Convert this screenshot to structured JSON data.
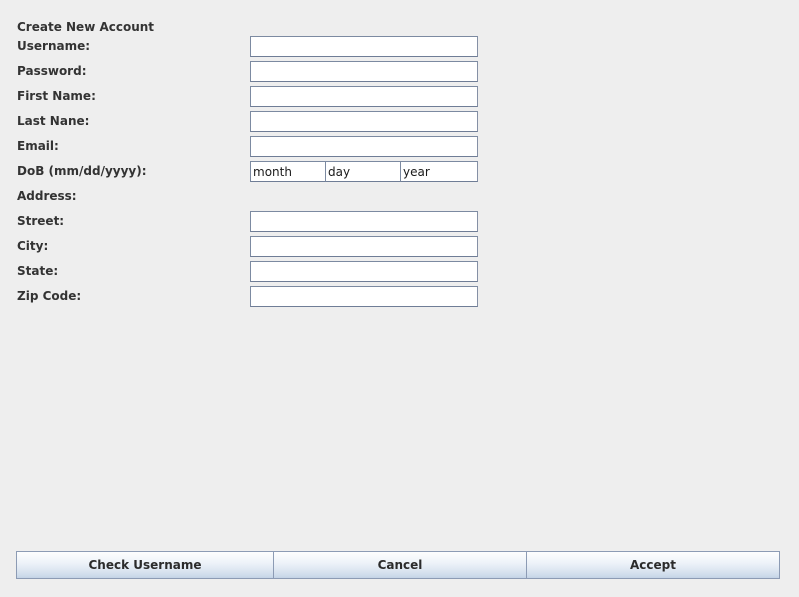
{
  "window": {
    "title": "Create New Account",
    "background_color": "#eeeeee"
  },
  "form": {
    "title": "Create New Account",
    "rows": [
      {
        "label": "Username:",
        "value": "",
        "type": "text"
      },
      {
        "label": "Password:",
        "value": "",
        "type": "text"
      },
      {
        "label": "First Name:",
        "value": "",
        "type": "text"
      },
      {
        "label": "Last Nane:",
        "value": "",
        "type": "text"
      },
      {
        "label": "Email:",
        "value": "",
        "type": "text"
      },
      {
        "label": "DoB (mm/dd/yyyy):",
        "value": "",
        "type": "dob"
      },
      {
        "label": "Address:",
        "value": "",
        "type": "section"
      },
      {
        "label": "Street:",
        "value": "",
        "type": "text"
      },
      {
        "label": "City:",
        "value": "",
        "type": "text"
      },
      {
        "label": "State:",
        "value": "",
        "type": "text"
      },
      {
        "label": "Zip Code:",
        "value": "",
        "type": "text"
      }
    ],
    "dob": {
      "month_value": "month",
      "day_value": "day",
      "year_value": "year"
    }
  },
  "buttons": {
    "check_username_label": "Check Username",
    "cancel_label": "Cancel",
    "accept_label": "Accept"
  },
  "colors": {
    "background": "#eeeeee",
    "field_border": "#76839b",
    "field_background": "#ffffff",
    "text": "#333333",
    "button_gradient_top": "#fdfefe",
    "button_gradient_bottom": "#c3d2e5",
    "button_border": "#8c9bb4"
  }
}
